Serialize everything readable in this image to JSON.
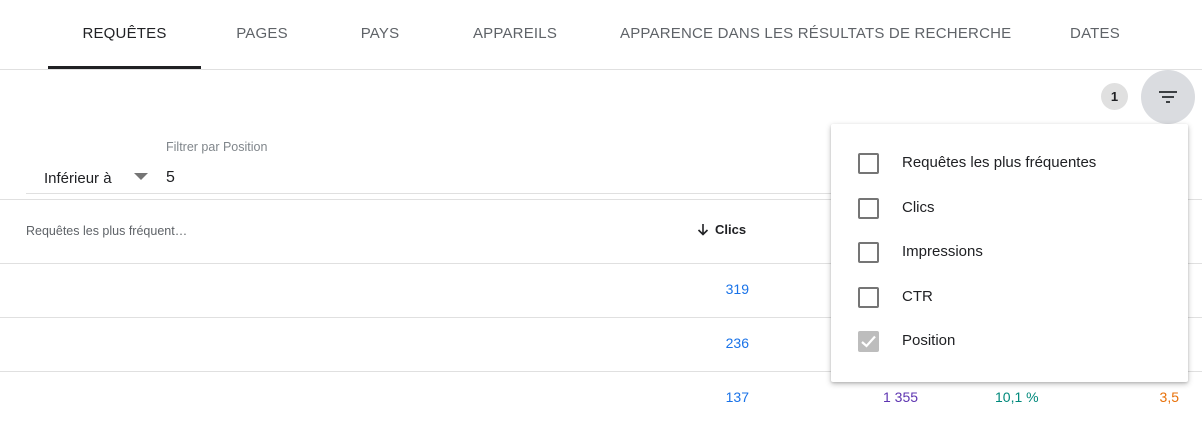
{
  "tabs": [
    {
      "label": "REQUÊTES",
      "active": true
    },
    {
      "label": "PAGES",
      "active": false
    },
    {
      "label": "PAYS",
      "active": false
    },
    {
      "label": "APPAREILS",
      "active": false
    },
    {
      "label": "APPARENCE DANS LES RÉSULTATS DE RECHERCHE",
      "active": false
    },
    {
      "label": "DATES",
      "active": false
    }
  ],
  "toolbar": {
    "active_filter_count": "1",
    "filter_icon": "filter-list-icon"
  },
  "filter": {
    "operator": "Inférieur à",
    "field_label": "Filtrer par Position",
    "value": "5"
  },
  "table": {
    "columns": {
      "query": "Requêtes les plus fréquent…",
      "clicks": "Clics"
    },
    "sort_icon": "arrow-down-icon",
    "rows": [
      {
        "query": "",
        "clicks": "319",
        "impressions": "",
        "ctr": "",
        "position": ""
      },
      {
        "query": "",
        "clicks": "236",
        "impressions": "",
        "ctr": "",
        "position": ""
      },
      {
        "query": "",
        "clicks": "137",
        "impressions": "1 355",
        "ctr": "10,1 %",
        "position": "3,5"
      }
    ]
  },
  "menu": {
    "items": [
      {
        "label": "Requêtes les plus fréquentes",
        "checked": false
      },
      {
        "label": "Clics",
        "checked": false
      },
      {
        "label": "Impressions",
        "checked": false
      },
      {
        "label": "CTR",
        "checked": false
      },
      {
        "label": "Position",
        "checked": true
      }
    ]
  },
  "colors": {
    "clicks": "#1a73e8",
    "impressions": "#5e35b1",
    "ctr": "#00897b",
    "position": "#e8710a"
  }
}
